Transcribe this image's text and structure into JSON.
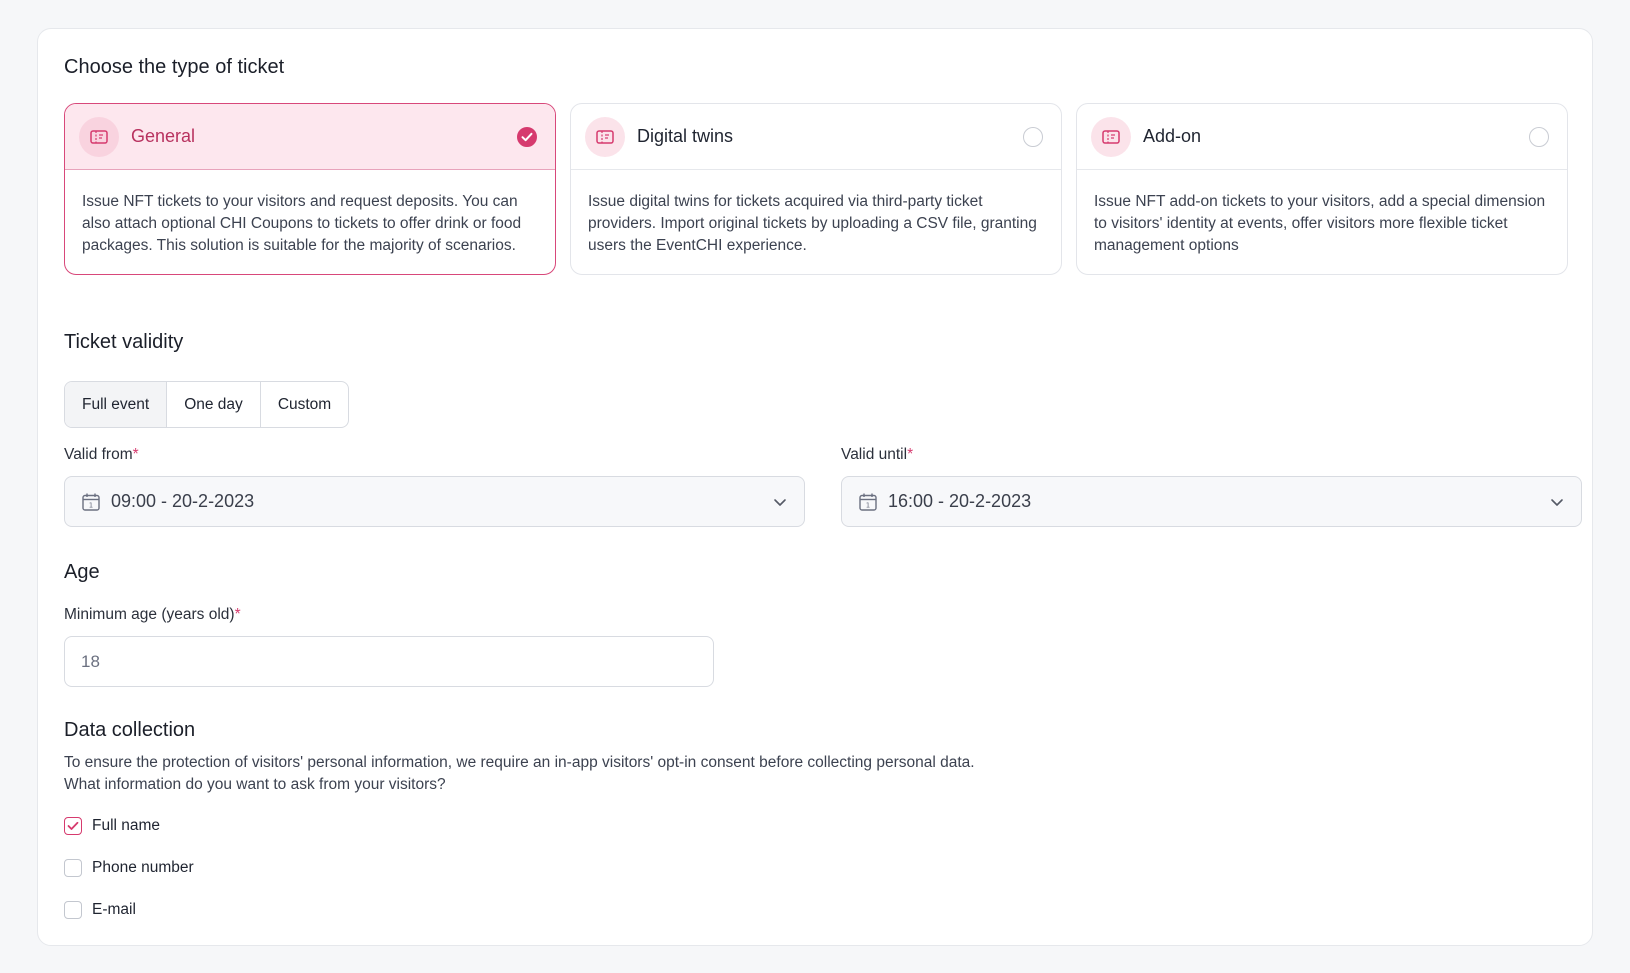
{
  "ticket_type": {
    "title": "Choose the type of ticket",
    "options": [
      {
        "title": "General",
        "description": "Issue NFT tickets to your visitors and request deposits. You can also attach optional CHI Coupons to tickets to offer drink or food packages. This solution is suitable for the majority of scenarios.",
        "selected": true,
        "icon": "ticket-icon"
      },
      {
        "title": "Digital twins",
        "description": "Issue digital twins for tickets acquired via third-party ticket providers. Import original tickets by uploading a CSV file, granting users the EventCHI experience.",
        "selected": false,
        "icon": "ticket-icon"
      },
      {
        "title": "Add-on",
        "description": "Issue NFT add-on tickets to your visitors, add a special dimension to visitors' identity at events, offer visitors more flexible ticket management options",
        "selected": false,
        "icon": "ticket-icon"
      }
    ]
  },
  "validity": {
    "title": "Ticket validity",
    "options": [
      "Full event",
      "One day",
      "Custom"
    ],
    "selected": "Full event",
    "valid_from_label": "Valid from",
    "valid_from_value": "09:00 - 20-2-2023",
    "valid_until_label": "Valid until",
    "valid_until_value": "16:00 - 20-2-2023",
    "required_mark": "*"
  },
  "age": {
    "title": "Age",
    "min_age_label": "Minimum age (years old)",
    "min_age_placeholder": "18",
    "required_mark": "*"
  },
  "data_collection": {
    "title": "Data collection",
    "description_line1": "To ensure the protection of visitors' personal information, we require an in-app visitors' opt-in consent before collecting personal data.",
    "description_line2": "What information do you want to ask from your visitors?",
    "fields": [
      {
        "label": "Full name",
        "checked": true
      },
      {
        "label": "Phone number",
        "checked": false
      },
      {
        "label": "E-mail",
        "checked": false
      }
    ]
  },
  "colors": {
    "accent": "#d63a6e",
    "accent_light": "#fde7ee",
    "border": "#d8dbe1"
  }
}
